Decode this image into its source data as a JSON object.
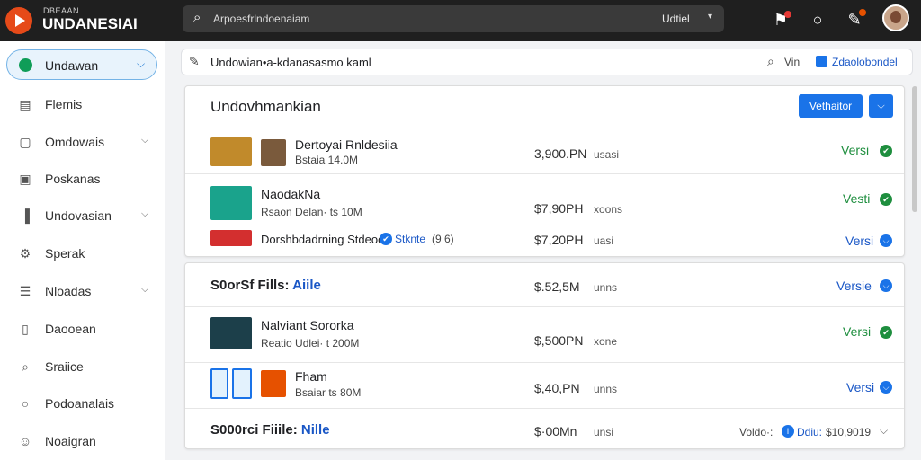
{
  "app": {
    "brand_sub": "DBEAAN",
    "brand_main": "UNDANESIAI"
  },
  "search": {
    "text": "Arpoesfrlndoenaiam",
    "selector": "Udtiel"
  },
  "sidebar": {
    "active": "Undawan",
    "items": [
      {
        "label": "Flemis"
      },
      {
        "label": "Omdowais"
      },
      {
        "label": "Poskanas"
      },
      {
        "label": "Undovasian"
      },
      {
        "label": "Sperak"
      },
      {
        "label": "Nloadas"
      },
      {
        "label": "Daooean"
      },
      {
        "label": "Sraiice"
      },
      {
        "label": "Podoanalais"
      },
      {
        "label": "Noaigran"
      }
    ]
  },
  "filter": {
    "text": "Undowian•a-kdanasasmo kaml",
    "search_label": "Vin",
    "checkbox_label": "Zdaolobondel"
  },
  "panel1": {
    "title": "Undovhmankian",
    "button": "Vethaitor",
    "rows": [
      {
        "title": "Dertoyai Rnldesiia",
        "sub": "Bstaia 14.0M",
        "price": "3,900.PN",
        "unit": "usasi",
        "status": "Versi",
        "tone": "green"
      },
      {
        "title": "NaodakNa",
        "sub": "Rsaon Delan· ts 10M",
        "price": "$7,90PH",
        "unit": "xoons",
        "status": "Vesti",
        "tone": "green"
      },
      {
        "title": "Dorshbdadrning Stdeoo",
        "link": "Stknte",
        "extra": "(9 6)",
        "price": "$7,20PH",
        "unit": "uasi",
        "status": "Versi",
        "tone": "blue"
      }
    ]
  },
  "panel2": {
    "header1_prefix": "S0orSf Fills:",
    "header1_link": "Aiile",
    "header1_price": "$.52,5M",
    "header1_unit": "unns",
    "header1_status": "Versie",
    "rows": [
      {
        "title": "Nalviant Sororka",
        "sub": "Reatio Udlei· t 200M",
        "price": "$,500PN",
        "unit": "xone",
        "status": "Versi",
        "tone": "green"
      },
      {
        "title": "Fham",
        "sub": "Bsaiar ts 80M",
        "price": "$,40,PN",
        "unit": "unns",
        "status": "Versi",
        "tone": "blue"
      }
    ],
    "header2_prefix": "S000rci Fiiile:",
    "header2_link": "Nille",
    "header2_price": "$·00Mn",
    "header2_unit": "unsi",
    "header2_status_prefix": "Voldo·:",
    "header2_status_link": "Ddiu:",
    "header2_status_val": "$10,9019"
  }
}
